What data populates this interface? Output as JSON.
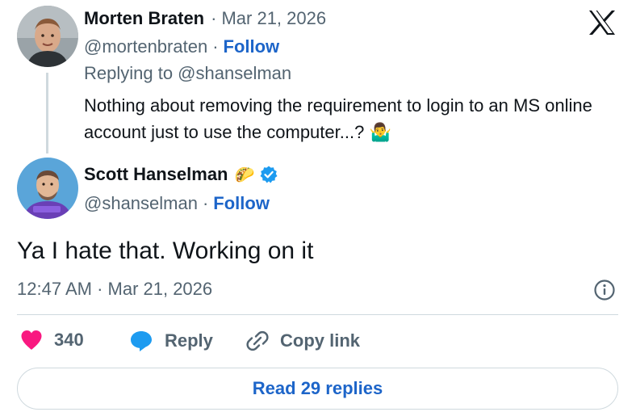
{
  "reply_to_tweet": {
    "author_name": "Morten Braten",
    "separator": "·",
    "date": "Mar 21, 2026",
    "handle": "@mortenbraten",
    "follow_label": "Follow",
    "replying_to": "Replying to @shanselman",
    "text": "Nothing about removing the requirement to login to an MS online account just to use the computer...?",
    "emoji": "🤷‍♂️"
  },
  "main_tweet": {
    "author_name": "Scott Hanselman",
    "badge_emoji": "🌮",
    "handle": "@shanselman",
    "separator": "·",
    "follow_label": "Follow",
    "text": "Ya I hate that. Working on it",
    "timestamp": "12:47 AM · Mar 21, 2026"
  },
  "actions": {
    "like_count": "340",
    "reply_label": "Reply",
    "copy_link_label": "Copy link"
  },
  "read_replies_label": "Read 29 replies",
  "colors": {
    "like": "#f91880",
    "reply": "#1d9bf0",
    "link": "#1d65c9",
    "verified": "#1d9bf0"
  },
  "icons": [
    "x-logo-icon",
    "verified-badge-icon",
    "info-icon",
    "heart-icon",
    "reply-bubble-icon",
    "link-icon"
  ]
}
